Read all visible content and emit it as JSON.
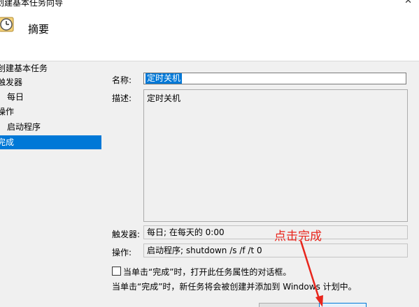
{
  "window": {
    "title": "创建基本任务向导",
    "close_glyph": "✕"
  },
  "header": {
    "title": "摘要",
    "icon": "clock-calendar-icon"
  },
  "sidebar": {
    "items": [
      {
        "label": "创建基本任务"
      },
      {
        "label": "触发器"
      },
      {
        "label": "每日"
      },
      {
        "label": "操作"
      },
      {
        "label": "启动程序"
      },
      {
        "label": "完成"
      }
    ],
    "selected_index": 5,
    "selected_color": "#0078d7"
  },
  "form": {
    "name_label": "名称:",
    "name_value": "定时关机",
    "desc_label": "描述:",
    "desc_value": "定时关机",
    "trigger_label": "触发器:",
    "trigger_value": "每日; 在每天的 0:00",
    "action_label": "操作:",
    "action_value": "启动程序; shutdown /s /f /t 0"
  },
  "annotation": {
    "text": "点击完成",
    "color": "#e8251c"
  },
  "options": {
    "open_properties_label": "当单击“完成”时，打开此任务属性的对话框。",
    "open_properties_checked": false,
    "note": "当单击“完成”时，新任务将会被创建并添加到 Windows 计划中。"
  }
}
